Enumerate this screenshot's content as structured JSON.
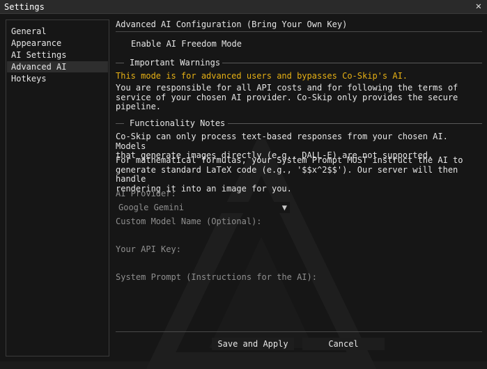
{
  "window": {
    "title": "Settings"
  },
  "sidebar": {
    "items": [
      {
        "label": "General"
      },
      {
        "label": "Appearance"
      },
      {
        "label": "AI Settings"
      },
      {
        "label": "Advanced AI",
        "active": true
      },
      {
        "label": "Hotkeys"
      }
    ]
  },
  "main": {
    "heading": "Advanced AI Configuration (Bring Your Own Key)",
    "freedom_checkbox": {
      "label": "Enable AI Freedom Mode",
      "checked": false
    },
    "warnings": {
      "title": "Important Warnings",
      "warning_line": "This mode is for advanced users and bypasses Co-Skip's AI.",
      "body": "You are responsible for all API costs and for following the terms of\nservice of your chosen AI provider. Co-Skip only provides the secure\npipeline."
    },
    "notes": {
      "title": "Functionality Notes",
      "para1": "Co-Skip can only process text-based responses from your chosen AI. Models\nthat generate images directly (e.g., DALL-E) are not supported.",
      "para2": "For mathematical formulas, your System Prompt MUST instruct the AI to\ngenerate standard LaTeX code (e.g., '$$x^2$$'). Our server will then handle\nrendering it into an image for you."
    },
    "provider": {
      "label": "AI Provider:",
      "selected": "Google Gemini"
    },
    "model_name": {
      "label": "Custom Model Name (Optional):",
      "value": ""
    },
    "api_key": {
      "label": "Your API Key:",
      "value": ""
    },
    "system_prompt": {
      "label": "System Prompt (Instructions for the AI):",
      "value": ""
    },
    "buttons": {
      "save": "Save and Apply",
      "cancel": "Cancel"
    }
  },
  "colors": {
    "warning": "#e6b014",
    "background": "#161616",
    "text": "#e6e6e6",
    "muted_label": "#8f8f8f"
  }
}
